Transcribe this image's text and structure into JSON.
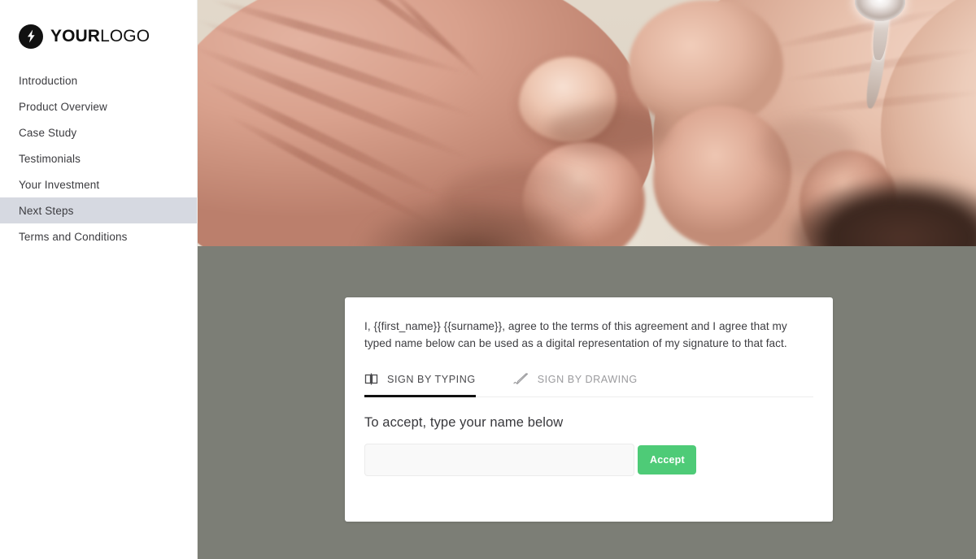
{
  "brand": {
    "logo_icon": "lightning-bolt-icon",
    "name_bold": "YOUR",
    "name_light": "LOGO"
  },
  "sidebar": {
    "items": [
      {
        "label": "Introduction",
        "active": false
      },
      {
        "label": "Product Overview",
        "active": false
      },
      {
        "label": "Case Study",
        "active": false
      },
      {
        "label": "Testimonials",
        "active": false
      },
      {
        "label": "Your Investment",
        "active": false
      },
      {
        "label": "Next Steps",
        "active": true
      },
      {
        "label": "Terms and Conditions",
        "active": false
      }
    ],
    "active_item": "Next Steps",
    "active_highlight_color": "#d6d9e1"
  },
  "hero": {
    "alt": "Close-up photograph of two clasped hands with an engagement ring on one finger",
    "icon": "hands-clasped-photo"
  },
  "signature_card": {
    "agreement_text": "I, {{first_name}} {{surname}}, agree to the terms of this agreement and I agree that my typed name below can be used as a digital representation of my signature to that fact.",
    "tabs": [
      {
        "label": "SIGN BY TYPING",
        "icon": "typing-keyboard-icon",
        "active": true
      },
      {
        "label": "SIGN BY DRAWING",
        "icon": "pen-drawing-icon",
        "active": false
      }
    ],
    "field_label": "To accept, type your name below",
    "name_input_value": "",
    "name_input_placeholder": "",
    "accept_label": "Accept",
    "accept_color": "#4ecb77"
  },
  "theme": {
    "page_background": "#7c7e76",
    "sidebar_background": "#ffffff",
    "card_background": "#ffffff",
    "active_tab_underline": "#111111"
  }
}
